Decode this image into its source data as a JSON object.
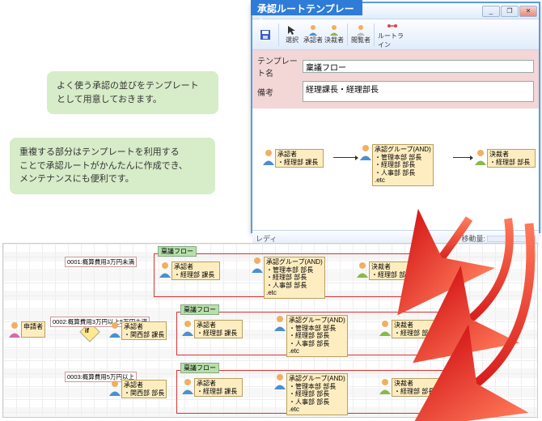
{
  "banner": "承認ルートテンプレート",
  "window_controls": {
    "min": "_",
    "max": "❐",
    "close": "✕"
  },
  "toolbar": {
    "save": "",
    "sel": "選択",
    "appr": "承認者",
    "dec": "決裁者",
    "view": "閲覧者",
    "route": "ルートライン"
  },
  "form": {
    "name_label": "テンプレート名",
    "name_value": "稟議フロー",
    "note_label": "備考",
    "note_value": "経理課長・経理部長"
  },
  "template_flow": {
    "n1": {
      "title": "承認者",
      "line": "・経理部 課長"
    },
    "n2": {
      "title": "承認グループ(AND)",
      "l1": "・管理本部 部長",
      "l2": "・経理部 部長",
      "l3": "・人事部 部長",
      "l4": ".etc"
    },
    "n3": {
      "title": "決裁者",
      "line": "・経理部 部長"
    }
  },
  "status": {
    "left": "レディ",
    "right": "移動量:"
  },
  "bubble1": {
    "l1": "よく使う承認の並びをテンプレート",
    "l2": "として用意しておきます。"
  },
  "bubble2": {
    "l1": "重複する部分はテンプレートを利用する",
    "l2": "ことで承認ルートがかんたんに作成でき、",
    "l3": "メンテナンスにも便利です。"
  },
  "lower": {
    "applicant": "申請者",
    "branch1": "0001:概算費用3万円未満",
    "branch2": "0002:概算費用3万円以上5万円未満",
    "branch3": "0003:概算費用5万円以上",
    "if": "if",
    "frame_title": "稟議フロー",
    "row1": {
      "a": {
        "title": "承認者",
        "line": "・経理部 課長"
      },
      "b": {
        "title": "承認グループ(AND)",
        "l1": "・管理本部 部長",
        "l2": "・経理部 部長",
        "l3": "・人事部 部長",
        "l4": ".etc"
      },
      "c": {
        "title": "決裁者",
        "line": "・経理部 部長"
      }
    },
    "row2": {
      "p": {
        "title": "承認者",
        "line": "・関西部 課長"
      },
      "a": {
        "title": "承認者",
        "line": "・経理部 課長"
      },
      "b": {
        "title": "承認グループ(AND)",
        "l1": "・管理本部 部長",
        "l2": "・経理部 部長",
        "l3": "・人事部 部長",
        "l4": ".etc"
      },
      "c": {
        "title": "決裁者",
        "line": "・経理部 部長"
      }
    },
    "row3": {
      "p": {
        "title": "承認者",
        "line": "・関西部 部長"
      },
      "a": {
        "title": "承認者",
        "line": "・経理部 課長"
      },
      "b": {
        "title": "承認グループ(AND)",
        "l1": "・管理本部 部長",
        "l2": "・経理部 部長",
        "l3": "・人事部 部長",
        "l4": ".etc"
      },
      "c": {
        "title": "決裁者",
        "line": "・経理部 部長"
      }
    }
  }
}
